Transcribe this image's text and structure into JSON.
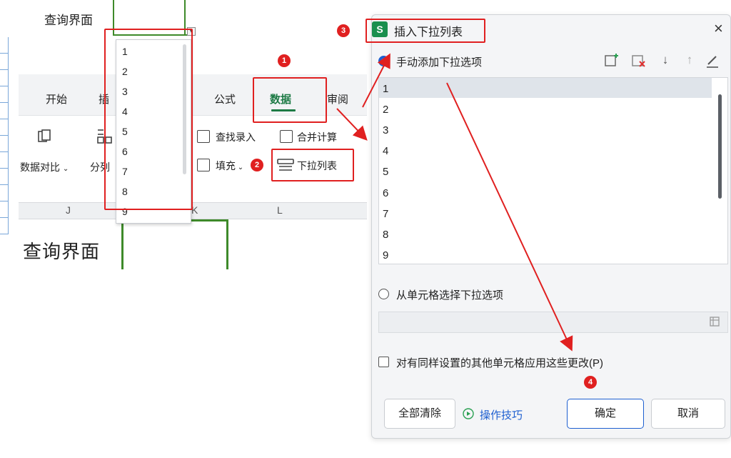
{
  "sheet": {
    "top_label": "查询界面",
    "big_label": "查询界面",
    "col_headers": [
      "J",
      "K",
      "L"
    ]
  },
  "ribbon": {
    "tabs": [
      "开始",
      "插",
      "公式",
      "数据",
      "审阅"
    ],
    "active_tab": "数据",
    "buttons": {
      "data_compare": "数据对比",
      "split": "分列",
      "find_entry": "查找录入",
      "merge_calc": "合并计算",
      "fill": "填充",
      "dropdown_list": "下拉列表"
    }
  },
  "dropdown_popup": {
    "items": [
      "1",
      "2",
      "3",
      "4",
      "5",
      "6",
      "7",
      "8",
      "9"
    ]
  },
  "badges": [
    "1",
    "2",
    "3",
    "4"
  ],
  "dialog": {
    "icon_letter": "S",
    "title": "插入下拉列表",
    "close": "×",
    "option_manual": "手动添加下拉选项",
    "option_cell": "从单元格选择下拉选项",
    "list_items": [
      "1",
      "2",
      "3",
      "4",
      "5",
      "6",
      "7",
      "8",
      "9"
    ],
    "apply_label": "对有同样设置的其他单元格应用这些更改(P)",
    "clear_all": "全部清除",
    "tips": "操作技巧",
    "ok": "确定",
    "cancel": "取消"
  },
  "colors": {
    "annotation_red": "#e02020",
    "accent_green": "#1d7a45",
    "accent_blue": "#1e5fd0",
    "cell_border_green": "#3e8a2a"
  }
}
